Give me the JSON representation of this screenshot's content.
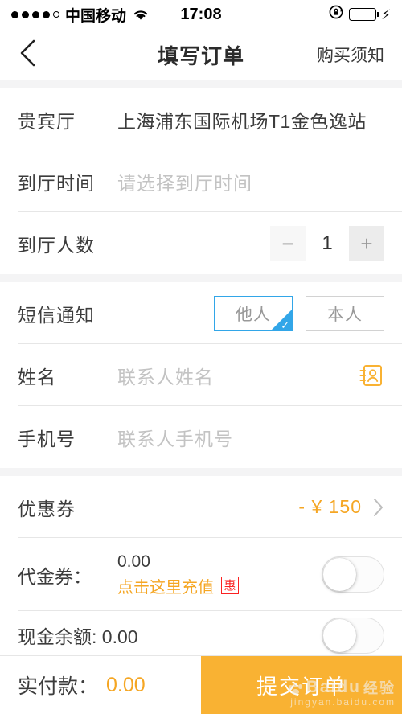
{
  "status_bar": {
    "carrier": "中国移动",
    "signal_dots_filled": 4,
    "signal_dots_total": 5,
    "wifi_icon": "wifi-icon",
    "time": "17:08",
    "rotation_lock_icon": "rotation-lock-icon",
    "battery_icon": "battery-icon",
    "battery_color": "#4cd964",
    "charging_icon": "lightning-bolt-icon"
  },
  "nav": {
    "back_icon": "chevron-left-icon",
    "title": "填写订单",
    "right_action": "购买须知"
  },
  "section_lounge": {
    "rows": [
      {
        "label": "贵宾厅",
        "value": "上海浦东国际机场T1金色逸站",
        "placeholder": ""
      },
      {
        "label": "到厅时间",
        "value": "",
        "placeholder": "请选择到厅时间"
      }
    ],
    "people": {
      "label": "到厅人数",
      "minus_label": "−",
      "plus_label": "+",
      "count": "1"
    }
  },
  "section_contact": {
    "sms": {
      "label": "短信通知",
      "options": [
        {
          "label": "他人",
          "selected": true
        },
        {
          "label": "本人",
          "selected": false
        }
      ],
      "check_icon": "check-icon",
      "selected_color": "#32a6e8"
    },
    "name": {
      "label": "姓名",
      "placeholder": "联系人姓名",
      "value": "",
      "icon": "contact-book-icon",
      "icon_color": "#f9b233"
    },
    "phone": {
      "label": "手机号",
      "placeholder": "联系人手机号",
      "value": ""
    }
  },
  "section_payment": {
    "coupon": {
      "label": "优惠券",
      "value": "- ¥ 150",
      "value_color": "#f5a623",
      "chevron_icon": "chevron-right-icon"
    },
    "voucher": {
      "label": "代金券：",
      "amount": "0.00",
      "recharge_link": "点击这里充值",
      "badge": "惠",
      "badge_color": "#fb2222",
      "toggle_on": false
    },
    "cash_balance": {
      "label": "现金余额: 0.00",
      "toggle_on": false
    }
  },
  "bottom_bar": {
    "pay_label": "实付款：",
    "pay_amount": "0.00",
    "pay_amount_color": "#f5a623",
    "submit_label": "提交订单",
    "submit_color": "#f9b233"
  },
  "watermark": {
    "brand": "Baidu",
    "suffix": "经验",
    "url": "jingyan.baidu.com",
    "paw_icon": "paw-icon"
  }
}
